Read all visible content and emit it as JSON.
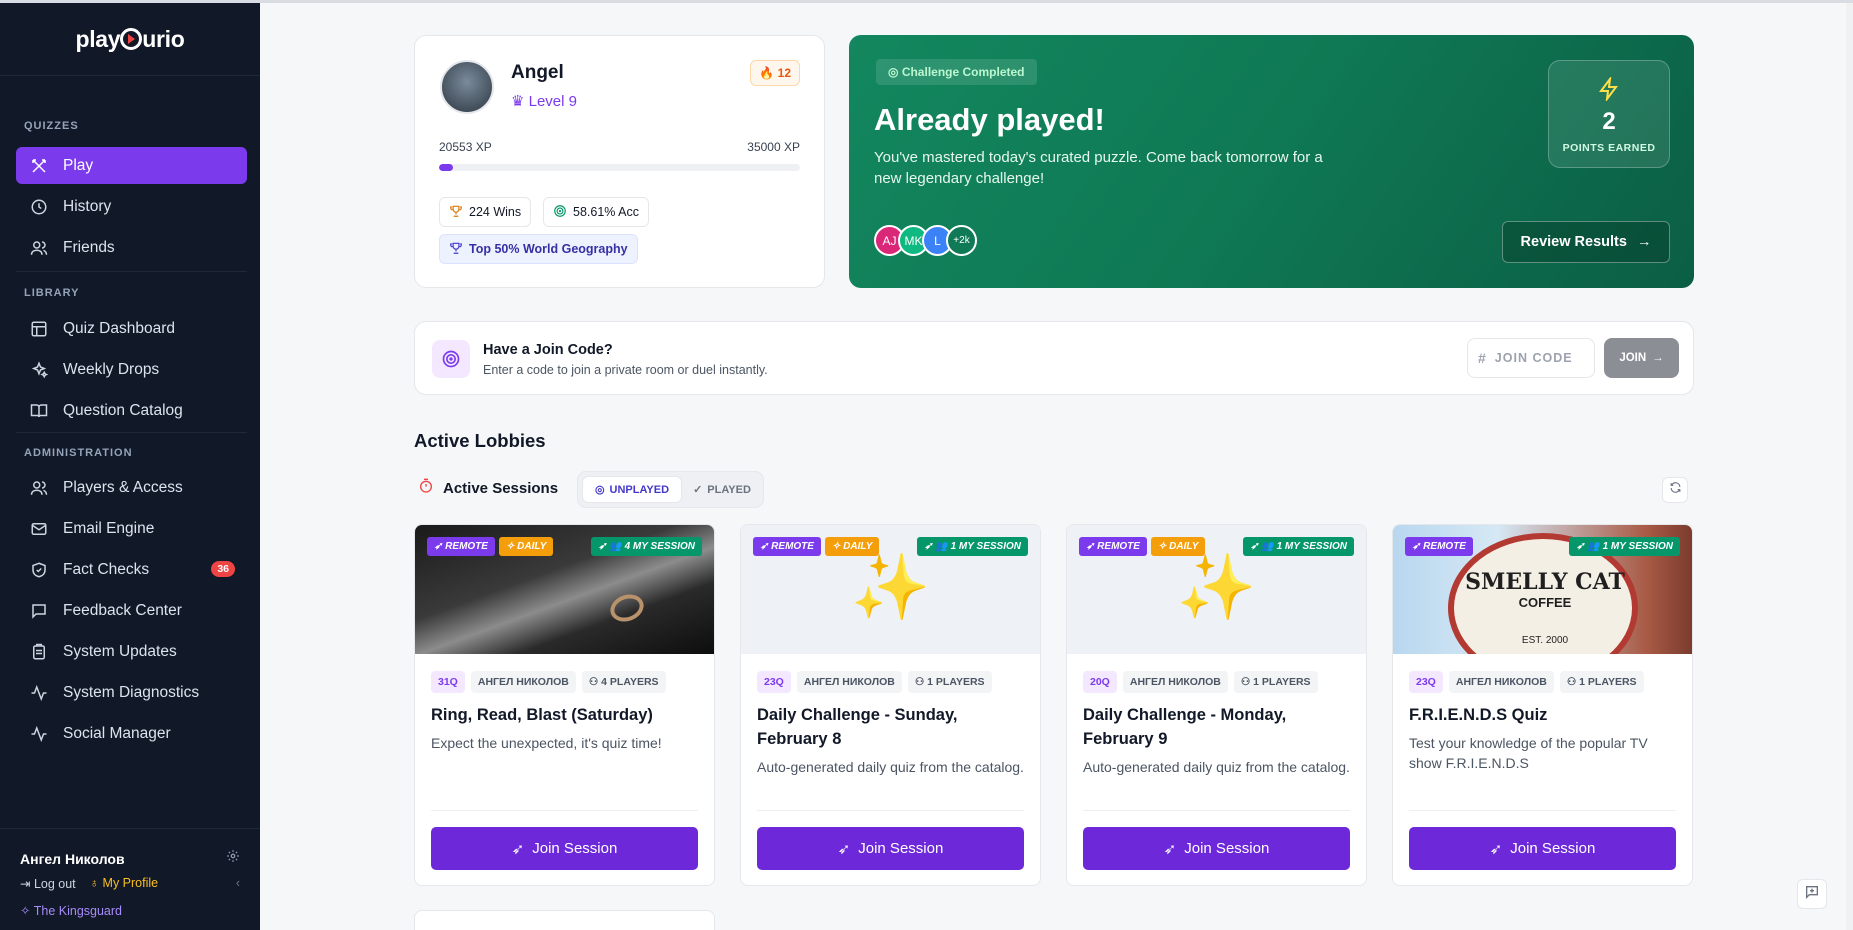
{
  "app": {
    "logo_left": "play",
    "logo_right": "urio"
  },
  "sidebar": {
    "sections": [
      "QUIZZES",
      "LIBRARY",
      "ADMINISTRATION"
    ],
    "items": [
      {
        "label": "Play",
        "icon": "swords-icon"
      },
      {
        "label": "History",
        "icon": "clock-icon"
      },
      {
        "label": "Friends",
        "icon": "users-icon"
      },
      {
        "label": "Quiz Dashboard",
        "icon": "layout-icon"
      },
      {
        "label": "Weekly Drops",
        "icon": "sparkles-icon"
      },
      {
        "label": "Question Catalog",
        "icon": "book-icon"
      },
      {
        "label": "Players & Access",
        "icon": "users-icon"
      },
      {
        "label": "Email Engine",
        "icon": "mail-icon"
      },
      {
        "label": "Fact Checks",
        "icon": "shield-icon",
        "badge": "36"
      },
      {
        "label": "Feedback Center",
        "icon": "message-icon"
      },
      {
        "label": "System Updates",
        "icon": "clipboard-icon"
      },
      {
        "label": "System Diagnostics",
        "icon": "activity-icon"
      },
      {
        "label": "Social Manager",
        "icon": "activity-icon"
      }
    ],
    "user": {
      "name": "Ангел Николов",
      "logout": "Log out",
      "profile": "My Profile",
      "team": "The Kingsguard"
    }
  },
  "profile": {
    "name": "Angel",
    "level": "Level 9",
    "streak": "12",
    "xp_current": "20553 XP",
    "xp_max": "35000 XP",
    "xp_progress": 0.04,
    "wins": "224 Wins",
    "accuracy": "58.61% Acc",
    "rank": "Top 50% World Geography"
  },
  "challenge": {
    "tag": "Challenge Completed",
    "title": "Already played!",
    "description": "You've mastered today's curated puzzle. Come back tomorrow for a new legendary challenge!",
    "points": "2",
    "points_label": "POINTS EARNED",
    "players": [
      {
        "initials": "AJ",
        "color": "#db2777"
      },
      {
        "initials": "MK",
        "color": "#10b981"
      },
      {
        "initials": "L",
        "color": "#3b82f6"
      },
      {
        "initials": "+2k",
        "color": "#0f7a55"
      }
    ],
    "review_label": "Review Results"
  },
  "join": {
    "title": "Have a Join Code?",
    "subtitle": "Enter a code to join a private room or duel instantly.",
    "placeholder": "JOIN CODE",
    "button": "JOIN"
  },
  "lobbies": {
    "title": "Active Lobbies",
    "sessions_label": "Active Sessions",
    "tab_unplayed": "UNPLAYED",
    "tab_played": "PLAYED",
    "join_label": "Join Session",
    "cards": [
      {
        "tags": [
          "REMOTE",
          "DAILY"
        ],
        "session": "4  MY SESSION",
        "questions": "31Q",
        "author": "АНГЕЛ НИКОЛОВ",
        "players": "4 PLAYERS",
        "title": "Ring, Read, Blast (Saturday)",
        "description": "Expect the unexpected, it's quiz time!",
        "media": "ring"
      },
      {
        "tags": [
          "REMOTE",
          "DAILY"
        ],
        "session": "1  MY SESSION",
        "questions": "23Q",
        "author": "АНГЕЛ НИКОЛОВ",
        "players": "1 PLAYERS",
        "title": "Daily Challenge - Sunday, February 8",
        "description": "Auto-generated daily quiz from the catalog.",
        "media": "sparkle"
      },
      {
        "tags": [
          "REMOTE",
          "DAILY"
        ],
        "session": "1  MY SESSION",
        "questions": "20Q",
        "author": "АНГЕЛ НИКОЛОВ",
        "players": "1 PLAYERS",
        "title": "Daily Challenge - Monday, February 9",
        "description": "Auto-generated daily quiz from the catalog.",
        "media": "sparkle"
      },
      {
        "tags": [
          "REMOTE"
        ],
        "session": "1  MY SESSION",
        "questions": "23Q",
        "author": "АНГЕЛ НИКОЛОВ",
        "players": "1 PLAYERS",
        "title": "F.R.I.E.N.D.S Quiz",
        "description": "Test your knowledge of the popular TV show F.R.I.E.N.D.S",
        "media": "cat",
        "sign_top": "SMELLY CAT",
        "sign_mid": "COFFEE",
        "sign_bottom": "EST. 2000"
      }
    ]
  }
}
